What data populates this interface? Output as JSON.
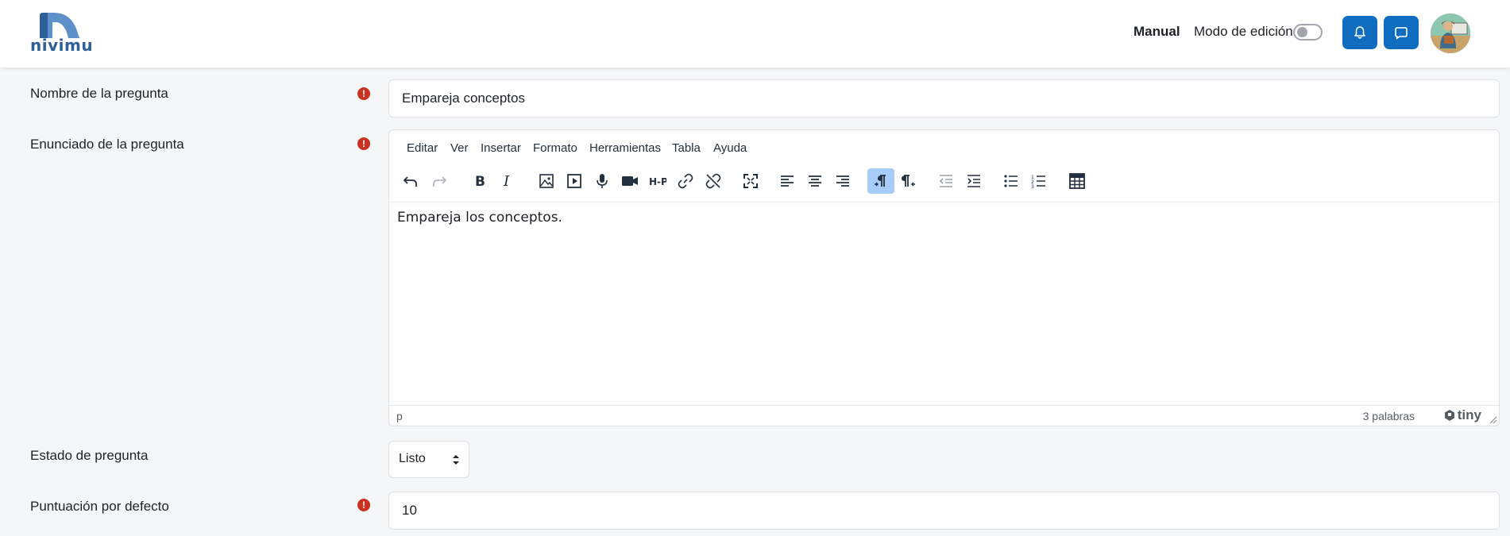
{
  "header": {
    "logo_text": "nivimu",
    "nav_manual": "Manual",
    "edit_mode_label": "Modo de edición",
    "edit_mode_on": false,
    "notification_icon": "bell-icon",
    "messages_icon": "chat-icon"
  },
  "form": {
    "question_name": {
      "label": "Nombre de la pregunta",
      "value": "Empareja conceptos",
      "required_icon": "!"
    },
    "question_text": {
      "label": "Enunciado de la pregunta",
      "required_icon": "!",
      "editor": {
        "menu": [
          "Editar",
          "Ver",
          "Insertar",
          "Formato",
          "Herramientas",
          "Tabla",
          "Ayuda"
        ],
        "toolbar": [
          "undo-icon",
          "redo-icon",
          "bold-icon",
          "italic-icon",
          "image-icon",
          "media-icon",
          "microphone-icon",
          "video-camera-icon",
          "h5p-icon",
          "link-icon",
          "unlink-icon",
          "fullscreen-icon",
          "align-left-icon",
          "align-center-icon",
          "align-right-icon",
          "ltr-icon",
          "rtl-icon",
          "outdent-icon",
          "indent-icon",
          "bullet-list-icon",
          "numbered-list-icon",
          "equation-calculator-icon"
        ],
        "h5p_label": "H-P",
        "content": "Empareja los conceptos.",
        "status_path": "p",
        "word_count": "3 palabras",
        "brand": "tiny"
      }
    },
    "question_status": {
      "label": "Estado de pregunta",
      "selected": "Listo"
    },
    "default_mark": {
      "label": "Puntuación por defecto",
      "value": "10",
      "required_icon": "!"
    }
  },
  "colors": {
    "primary": "#0f6cbf",
    "required": "#ca3120",
    "active_tool": "#a6ccf7",
    "page_bg": "#f5f6f8"
  }
}
